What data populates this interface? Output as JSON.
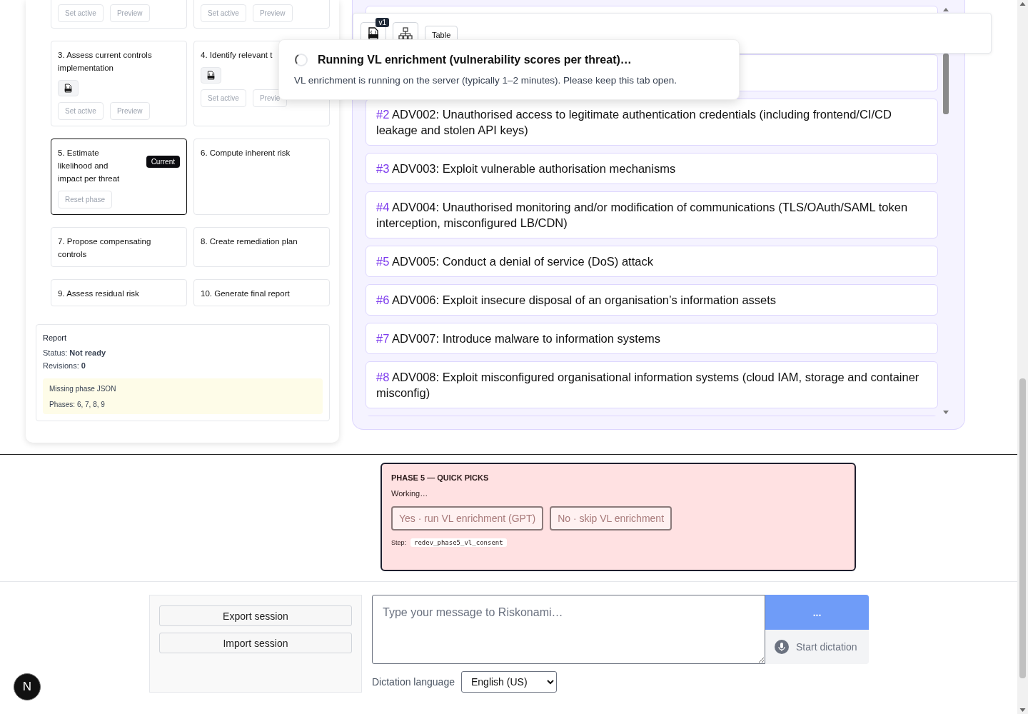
{
  "phases": [
    {
      "current": false,
      "json_file": false,
      "buttons": [
        "Set active",
        "Preview"
      ]
    },
    {
      "current": false,
      "json_file": false,
      "buttons": [
        "Set active",
        "Preview"
      ]
    },
    {
      "title": "3. Assess current controls implementation",
      "current": false,
      "json_file": true,
      "buttons": [
        "Set active",
        "Preview"
      ]
    },
    {
      "title": "4. Identify relevant t",
      "current": false,
      "json_file": true,
      "buttons": [
        "Set active",
        "Previe"
      ]
    },
    {
      "title": "5. Estimate likelihood and impact per threat",
      "current": true,
      "badge": "Current",
      "json_file": false,
      "buttons": [
        "Reset phase"
      ]
    },
    {
      "title": "6. Compute inherent risk",
      "current": false,
      "json_file": false
    },
    {
      "title": "7. Propose compensating controls",
      "current": false,
      "json_file": false
    },
    {
      "title": "8. Create remediation plan",
      "current": false,
      "json_file": false
    },
    {
      "title": "9. Assess residual risk",
      "current": false,
      "json_file": false
    },
    {
      "title": "10. Generate final report",
      "current": false,
      "json_file": false
    }
  ],
  "report": {
    "title": "Report",
    "status": "Status: **Not ready**",
    "revisions": "Revisions: **0**",
    "warning_title": "Missing phase JSON",
    "warning_phases": "Phases: 6, 7, 8, 9"
  },
  "threat_view": {
    "toolbar": {
      "json_version": "v1",
      "table_button": "Table"
    },
    "threats": [
      {
        "kind": "hidden"
      },
      {
        "kind": "hidden"
      },
      {
        "kind": "threat",
        "number": "#2",
        "text": "ADV002: Unauthorised access to legitimate authentication credentials (including frontend/CI/CD leakage and stolen API keys)"
      },
      {
        "kind": "threat",
        "number": "#3",
        "text": "ADV003: Exploit vulnerable authorisation mechanisms"
      },
      {
        "kind": "threat",
        "number": "#4",
        "text": "ADV004: Unauthorised monitoring and/or modification of communications (TLS/OAuth/SAML token interception, misconfigured LB/CDN)"
      },
      {
        "kind": "threat",
        "number": "#5",
        "text": "ADV005: Conduct a denial of service (DoS) attack"
      },
      {
        "kind": "threat",
        "number": "#6",
        "text": "ADV006: Exploit insecure disposal of an organisation’s information assets"
      },
      {
        "kind": "threat",
        "number": "#7",
        "text": "ADV007: Introduce malware to information systems"
      },
      {
        "kind": "threat",
        "number": "#8",
        "text": "ADV008: Exploit misconfigured organisational information systems (cloud IAM, storage and container misconfig)"
      },
      {
        "kind": "hidden"
      }
    ]
  },
  "toast": {
    "title": "Running VL enrichment (vulnerability scores per threat)…",
    "message": "VL enrichment is running on the server (typically 1–2 minutes). Please keep this tab open."
  },
  "quick_picks": {
    "title": "PHASE 5 — QUICK PICKS",
    "status": "Working…",
    "buttons": [
      {
        "label": "Yes · run VL enrichment (GPT)",
        "disabled": true
      },
      {
        "label": "No · skip VL enrichment",
        "disabled": true
      }
    ],
    "step_label": "Step:",
    "step": "redev_phase5_vl_consent"
  },
  "chat": {
    "session_buttons": [
      "Export session",
      "Import session"
    ],
    "message_placeholder": "Type your message to Riskonami…",
    "send_button": "...",
    "dictation_button": "Start dictation",
    "language_label": "Dictation language",
    "language": "English (US)"
  },
  "dev_badge": "N"
}
